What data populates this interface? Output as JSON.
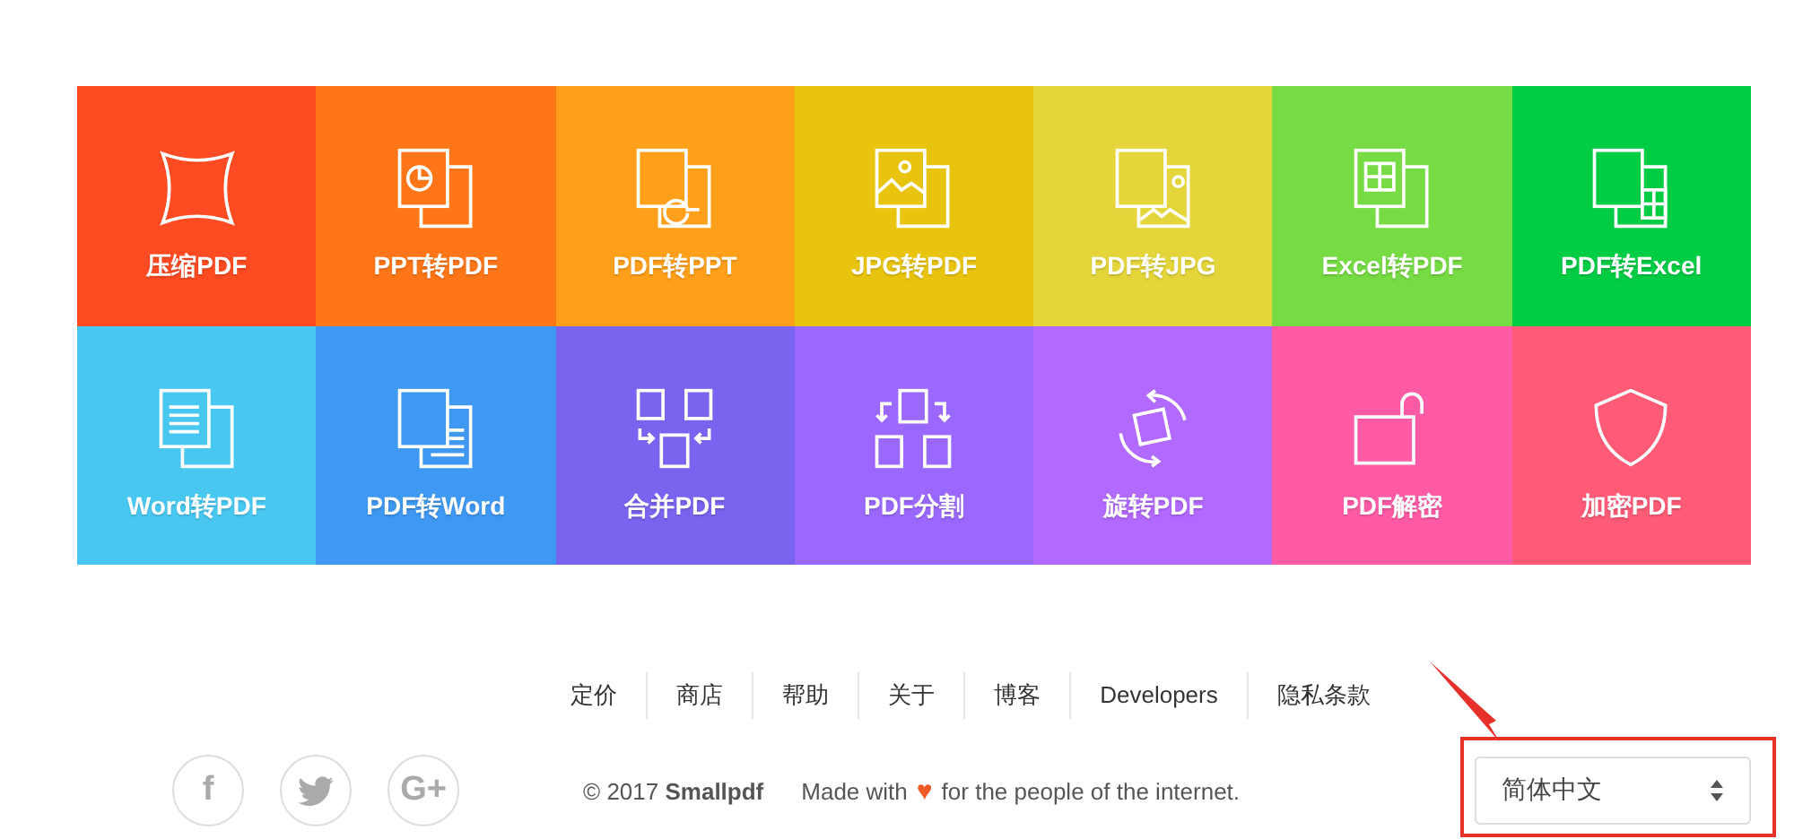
{
  "tools": [
    {
      "kind": "compress",
      "label": "压缩PDF",
      "color": "#ff4b22"
    },
    {
      "kind": "ppt-to-pdf",
      "label": "PPT转PDF",
      "color": "#ff7618"
    },
    {
      "kind": "pdf-to-ppt",
      "label": "PDF转PPT",
      "color": "#ff9f1a"
    },
    {
      "kind": "jpg-to-pdf",
      "label": "JPG转PDF",
      "color": "#e9c40f"
    },
    {
      "kind": "pdf-to-jpg",
      "label": "PDF转JPG",
      "color": "#e3d53a"
    },
    {
      "kind": "excel-to-pdf",
      "label": "Excel转PDF",
      "color": "#77db44"
    },
    {
      "kind": "pdf-to-excel",
      "label": "PDF转Excel",
      "color": "#00cc44"
    },
    {
      "kind": "word-to-pdf",
      "label": "Word转PDF",
      "color": "#48c8f1"
    },
    {
      "kind": "pdf-to-word",
      "label": "PDF转Word",
      "color": "#3f98f2"
    },
    {
      "kind": "merge",
      "label": "合并PDF",
      "color": "#7a63ef"
    },
    {
      "kind": "split",
      "label": "PDF分割",
      "color": "#9b68ff"
    },
    {
      "kind": "rotate",
      "label": "旋转PDF",
      "color": "#b269ff"
    },
    {
      "kind": "unlock",
      "label": "PDF解密",
      "color": "#ff5aa5"
    },
    {
      "kind": "protect",
      "label": "加密PDF",
      "color": "#ff5a76"
    }
  ],
  "footer_links": [
    "定价",
    "商店",
    "帮助",
    "关于",
    "博客",
    "Developers",
    "隐私条款"
  ],
  "social": [
    {
      "kind": "facebook",
      "text": "f"
    },
    {
      "kind": "twitter"
    },
    {
      "kind": "google",
      "text": "G+"
    }
  ],
  "copyright": "© 2017 **Smallpdf**",
  "made_with": {
    "before": "Made with",
    "heart": "♥",
    "after": "for the people of the internet."
  },
  "language_select": {
    "value": "简体中文"
  },
  "annotation": {
    "kind": "box-and-arrow"
  }
}
